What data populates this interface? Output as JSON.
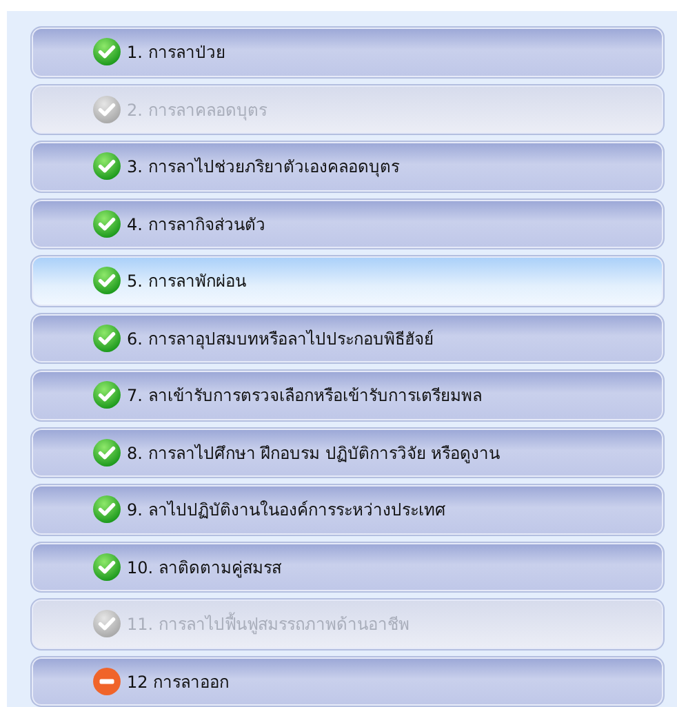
{
  "items": [
    {
      "label": "1. การลาป่วย",
      "kind": "check",
      "disabled": false,
      "selected": false
    },
    {
      "label": "2. การลาคลอดบุตร",
      "kind": "check",
      "disabled": true,
      "selected": false
    },
    {
      "label": "3. การลาไปช่วยภริยาตัวเองคลอดบุตร",
      "kind": "check",
      "disabled": false,
      "selected": false
    },
    {
      "label": "4. การลากิจส่วนตัว",
      "kind": "check",
      "disabled": false,
      "selected": false
    },
    {
      "label": "5. การลาพักผ่อน",
      "kind": "check",
      "disabled": false,
      "selected": true
    },
    {
      "label": "6. การลาอุปสมบทหรือลาไปประกอบพิธีฮัจย์",
      "kind": "check",
      "disabled": false,
      "selected": false
    },
    {
      "label": "7. ลาเข้ารับการตรวจเลือกหรือเข้ารับการเตรียมพล",
      "kind": "check",
      "disabled": false,
      "selected": false
    },
    {
      "label": "8. การลาไปศึกษา ฝึกอบรม ปฏิบัติการวิจัย หรือดูงาน",
      "kind": "check",
      "disabled": false,
      "selected": false
    },
    {
      "label": "9. ลาไปปฏิบัติงานในองค์การระหว่างประเทศ",
      "kind": "check",
      "disabled": false,
      "selected": false
    },
    {
      "label": "10. ลาติดตามคู่สมรส",
      "kind": "check",
      "disabled": false,
      "selected": false
    },
    {
      "label": "11. การลาไปฟื้นฟูสมรรถภาพด้านอาชีพ",
      "kind": "check",
      "disabled": true,
      "selected": false
    },
    {
      "label": "12 การลาออก",
      "kind": "minus",
      "disabled": false,
      "selected": false
    }
  ]
}
